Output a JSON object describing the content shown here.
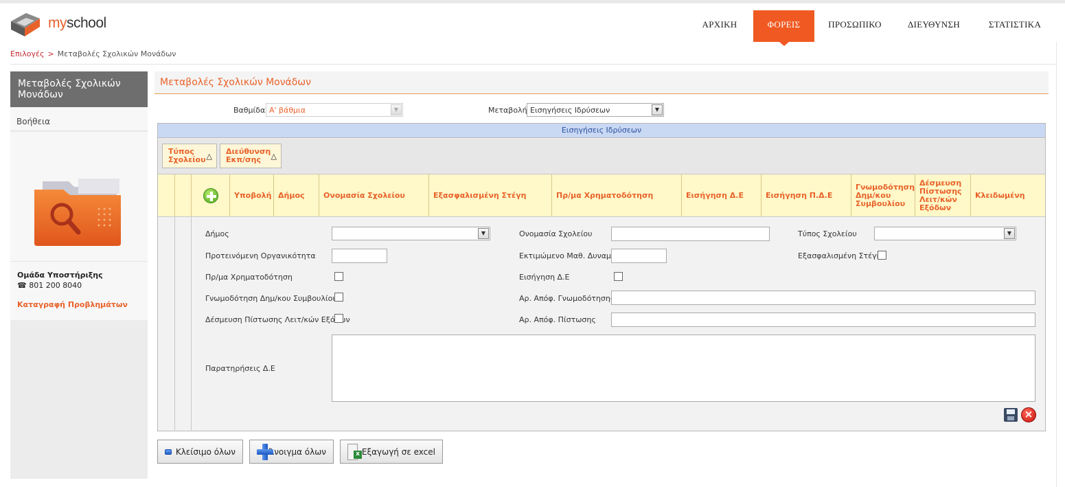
{
  "app": {
    "brand_my": "my",
    "brand_rest": "school"
  },
  "nav": [
    {
      "label": "ΑΡΧΙΚΗ",
      "active": false
    },
    {
      "label": "ΦΟΡΕΙΣ",
      "active": true
    },
    {
      "label": "ΠΡΟΣΩΠΙΚΟ",
      "active": false
    },
    {
      "label": "ΔΙΕΥΘΥΝΣΗ",
      "active": false
    },
    {
      "label": "ΣΤΑΤΙΣΤΙΚΑ",
      "active": false
    }
  ],
  "breadcrumb": {
    "home": "Επιλογές",
    "separator": ">",
    "current": "Μεταβολές Σχολικών Μονάδων"
  },
  "sidebar": {
    "title": "Μεταβολές Σχολικών Μονάδων",
    "help": "Βοήθεια",
    "support_title": "Ομάδα Υποστήριξης",
    "support_phone": "801 200 8040",
    "report_link": "Καταγραφή Προβλημάτων",
    "image_icon": "folder-search-icon"
  },
  "panel": {
    "title": "Μεταβολές Σχολικών Μονάδων"
  },
  "filters": {
    "level_label": "Βαθμίδα",
    "level_value": "Α' βάθμια",
    "change_label": "Μεταβολή",
    "change_value": "Εισηγήσεις Ιδρύσεων"
  },
  "grid": {
    "caption": "Εισηγήσεις Ιδρύσεων",
    "group_buttons": [
      "Τύπος Σχολείου",
      "Διεύθυνση Εκπ/σης"
    ],
    "sort_icon": "triangle-up-icon",
    "columns": [
      "Υποβολή",
      "Δήμος",
      "Ονομασία Σχολείου",
      "Εξασφαλισμένη Στέγη",
      "Πρ/μα Χρηματοδότηση",
      "Εισήγηση Δ.Ε",
      "Εισήγηση Π.Δ.Ε",
      "Γνωμοδότηση Δημ/κου Συμβουλίου",
      "Δέσμευση Πίστωσης Λειτ/κών Εξόδων",
      "Κλειδωμένη"
    ]
  },
  "form": {
    "dimos_label": "Δήμος",
    "school_name_label": "Ονομασία Σχολείου",
    "school_type_label": "Τύπος Σχολείου",
    "proposed_org_label": "Προτεινόμενη Οργανικότητα",
    "est_students_label": "Εκτιμώμενο Μαθ. Δυναμικό",
    "secured_housing_label": "Εξασφαλισμένη Στέγη",
    "funding_label": "Πρ/μα Χρηματοδότηση",
    "de_proposal_label": "Εισήγηση Δ.Ε",
    "council_opinion_label": "Γνωμοδότηση Δημ/κου Συμβουλίου",
    "opinion_decision_no_label": "Αρ. Απόφ. Γνωμοδότησης",
    "credit_commit_label": "Δέσμευση Πίστωσης Λειτ/κών Εξόδων",
    "credit_decision_no_label": "Αρ. Απόφ. Πίστωσης",
    "notes_label": "Παρατηρήσεις Δ.Ε"
  },
  "buttons": {
    "collapse_all": "Κλείσιμο όλων",
    "expand_all": "Άνοιγμα όλων",
    "export_excel": "Εξαγωγή σε excel"
  }
}
